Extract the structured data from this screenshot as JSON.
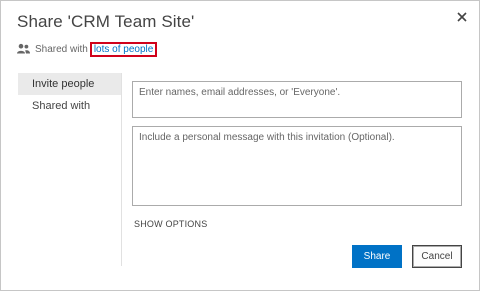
{
  "dialog": {
    "title": "Share 'CRM Team Site'",
    "close_icon": "close-icon"
  },
  "shared": {
    "icon": "people-icon",
    "prefix": "Shared with",
    "link_text": "lots of people"
  },
  "nav": {
    "items": [
      {
        "label": "Invite people",
        "selected": true
      },
      {
        "label": "Shared with",
        "selected": false
      }
    ]
  },
  "invite": {
    "names_placeholder": "Enter names, email addresses, or 'Everyone'.",
    "message_placeholder": "Include a personal message with this invitation (Optional).",
    "show_options": "SHOW OPTIONS"
  },
  "buttons": {
    "share": "Share",
    "cancel": "Cancel"
  },
  "colors": {
    "accent": "#0072c6",
    "highlight_box": "#d0021b"
  }
}
